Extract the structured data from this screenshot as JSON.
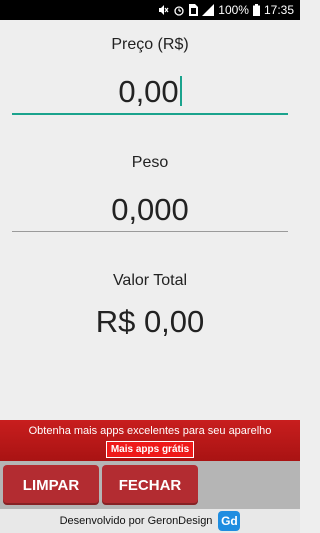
{
  "status_bar": {
    "battery": "100%",
    "time": "17:35",
    "icons": [
      "mute-icon",
      "alarm-icon",
      "sim-icon",
      "signal-icon",
      "battery-icon"
    ]
  },
  "price": {
    "label": "Preço (R$)",
    "value": "0,00"
  },
  "weight": {
    "label": "Peso",
    "value": "0,000"
  },
  "total": {
    "label": "Valor Total",
    "value": "R$ 0,00"
  },
  "promo": {
    "text": "Obtenha mais apps excelentes para seu aparelho",
    "button": "Mais apps grátis"
  },
  "actions": {
    "clear": "LIMPAR",
    "close": "FECHAR"
  },
  "footer": {
    "text": "Desenvolvido por GeronDesign",
    "logo": "Gd"
  },
  "colors": {
    "accent": "#1aa38d",
    "button": "#b32c31",
    "promo": "#c81e1e",
    "background": "#eeeeee"
  }
}
